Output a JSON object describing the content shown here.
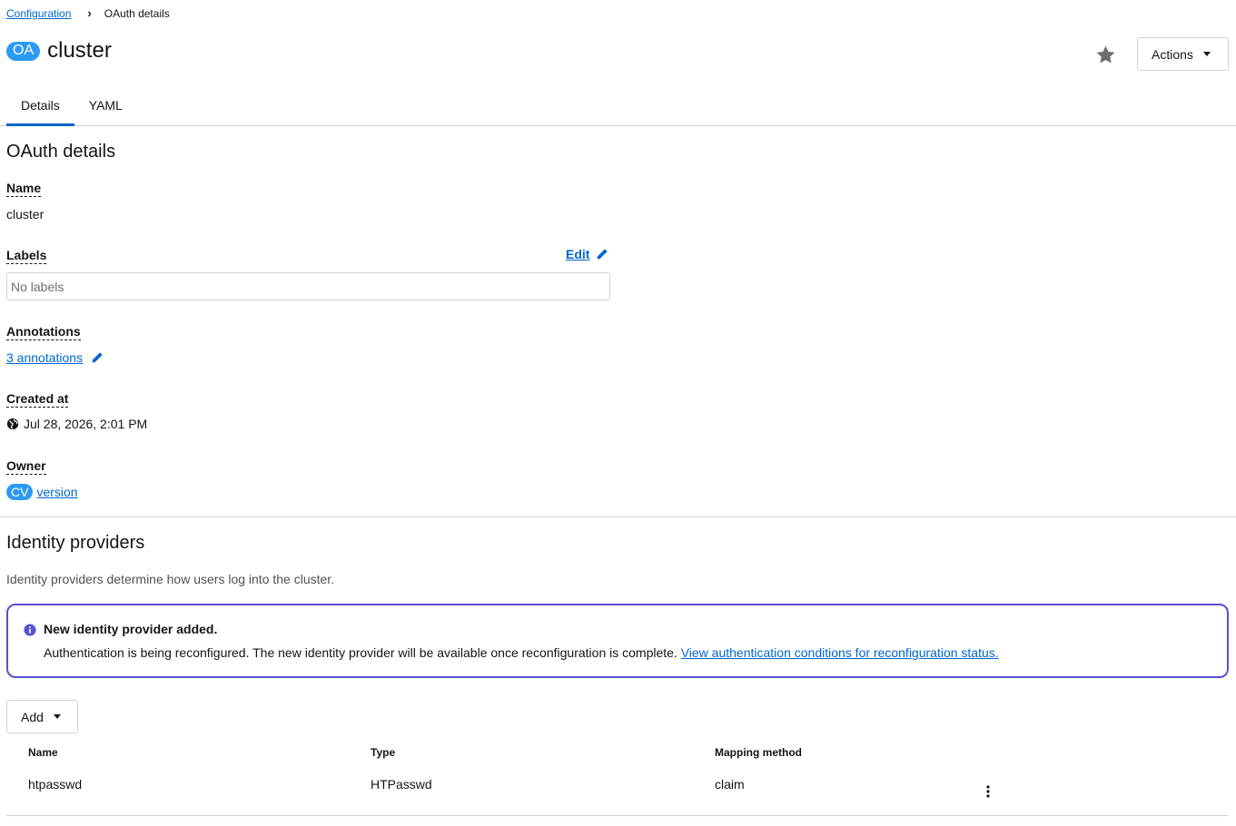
{
  "breadcrumb": {
    "parent": "Configuration",
    "current": "OAuth details"
  },
  "header": {
    "badge": "OA",
    "title": "cluster",
    "actions_label": "Actions"
  },
  "tabs": [
    {
      "label": "Details",
      "active": true
    },
    {
      "label": "YAML",
      "active": false
    }
  ],
  "details": {
    "section_title": "OAuth details",
    "name_label": "Name",
    "name_value": "cluster",
    "labels_label": "Labels",
    "labels_edit": "Edit",
    "labels_value": "No labels",
    "annotations_label": "Annotations",
    "annotations_value": "3 annotations",
    "created_label": "Created at",
    "created_value": "Jul 28, 2026, 2:01 PM",
    "owner_label": "Owner",
    "owner_badge": "CV",
    "owner_value": "version"
  },
  "identity": {
    "title": "Identity providers",
    "description": "Identity providers determine how users log into the cluster.",
    "alert_title": "New identity provider added.",
    "alert_body": "Authentication is being reconfigured. The new identity provider will be available once reconfiguration is complete.",
    "alert_link": "View authentication conditions for reconfiguration status.",
    "add_label": "Add",
    "columns": {
      "name": "Name",
      "type": "Type",
      "mapping": "Mapping method"
    },
    "rows": [
      {
        "name": "htpasswd",
        "type": "HTPasswd",
        "mapping": "claim"
      }
    ]
  },
  "colors": {
    "accent": "#0066cc",
    "badge": "#2b9af3",
    "alert_border": "#5752d1"
  },
  "icons": {
    "favorite": "star-icon",
    "edit": "pencil-icon",
    "timezone": "globe-icon",
    "info": "info-circle-icon",
    "row_actions": "kebab-icon"
  }
}
